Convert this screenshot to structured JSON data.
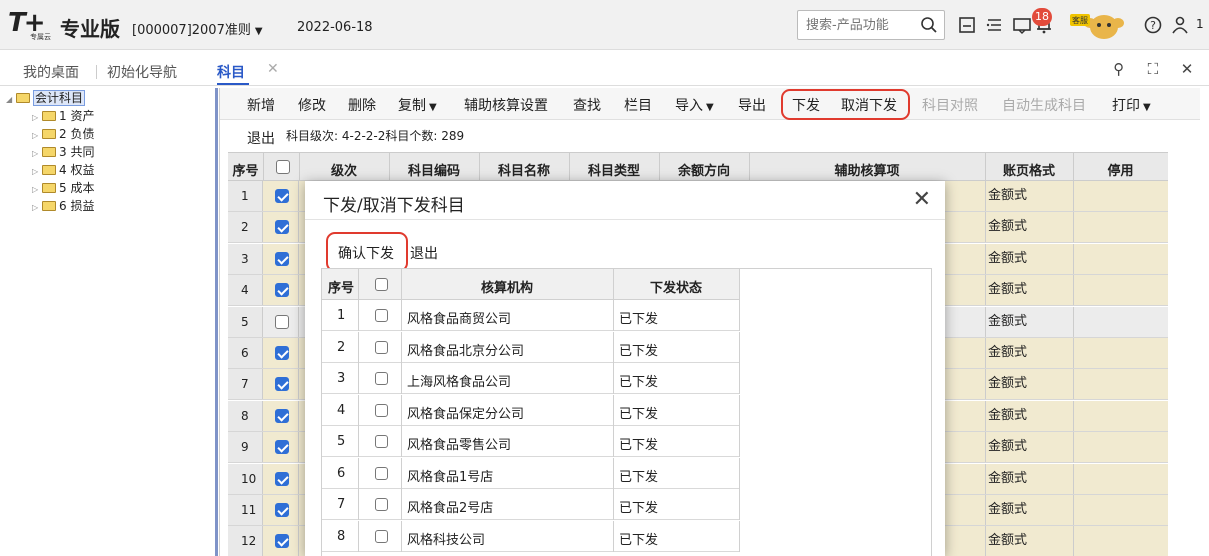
{
  "header": {
    "logo_text": "T+",
    "logo_sub": "专属云",
    "edition": "专业版",
    "account": "[000007]2007准则",
    "date": "2022-06-18",
    "search_placeholder": "搜索-产品功能",
    "notification_count": "18",
    "mascot_label": "客服",
    "user_count": "1"
  },
  "tabs": {
    "desktop": "我的桌面",
    "init_nav": "初始化导航",
    "subjects": "科目"
  },
  "tree": {
    "root": "会计科目",
    "items": [
      "1 资产",
      "2 负债",
      "3 共同",
      "4 权益",
      "5 成本",
      "6 损益"
    ]
  },
  "toolbar": {
    "add": "新增",
    "edit": "修改",
    "delete": "删除",
    "copy": "复制",
    "aux_setup": "辅助核算设置",
    "find": "查找",
    "columns": "栏目",
    "import": "导入",
    "export": "导出",
    "distribute": "下发",
    "cancel_distribute": "取消下发",
    "subject_compare": "科目对照",
    "auto_generate": "自动生成科目",
    "print": "打印"
  },
  "subbar": {
    "exit": "退出",
    "info": "科目级次: 4-2-2-2科目个数: 289"
  },
  "grid": {
    "headers": {
      "seq": "序号",
      "level": "级次",
      "code": "科目编码",
      "name": "科目名称",
      "type": "科目类型",
      "direction": "余额方向",
      "aux": "辅助核算项",
      "format": "账页格式",
      "disabled": "停用"
    },
    "rows": [
      {
        "seq": "1",
        "checked": true,
        "format": "金额式"
      },
      {
        "seq": "2",
        "checked": true,
        "format": "金额式"
      },
      {
        "seq": "3",
        "checked": true,
        "format": "金额式"
      },
      {
        "seq": "4",
        "checked": true,
        "format": "金额式"
      },
      {
        "seq": "5",
        "checked": false,
        "format": "金额式"
      },
      {
        "seq": "6",
        "checked": true,
        "format": "金额式"
      },
      {
        "seq": "7",
        "checked": true,
        "format": "金额式"
      },
      {
        "seq": "8",
        "checked": true,
        "format": "金额式"
      },
      {
        "seq": "9",
        "checked": true,
        "format": "金额式"
      },
      {
        "seq": "10",
        "checked": true,
        "format": "金额式"
      },
      {
        "seq": "11",
        "checked": true,
        "format": "金额式"
      },
      {
        "seq": "12",
        "checked": true,
        "format": "金额式"
      }
    ]
  },
  "modal": {
    "title": "下发/取消下发科目",
    "confirm": "确认下发",
    "exit": "退出",
    "headers": {
      "seq": "序号",
      "org": "核算机构",
      "status": "下发状态"
    },
    "rows": [
      {
        "seq": "1",
        "org": "风格食品商贸公司",
        "status": "已下发"
      },
      {
        "seq": "2",
        "org": "风格食品北京分公司",
        "status": "已下发"
      },
      {
        "seq": "3",
        "org": "上海风格食品公司",
        "status": "已下发"
      },
      {
        "seq": "4",
        "org": "风格食品保定分公司",
        "status": "已下发"
      },
      {
        "seq": "5",
        "org": "风格食品零售公司",
        "status": "已下发"
      },
      {
        "seq": "6",
        "org": "风格食品1号店",
        "status": "已下发"
      },
      {
        "seq": "7",
        "org": "风格食品2号店",
        "status": "已下发"
      },
      {
        "seq": "8",
        "org": "风格科技公司",
        "status": "已下发"
      }
    ]
  },
  "colors": {
    "row_yellow": "#f1ead0",
    "row_gray": "#ececec",
    "accent_blue": "#2a59c7",
    "highlight_red": "#e03a2e"
  }
}
